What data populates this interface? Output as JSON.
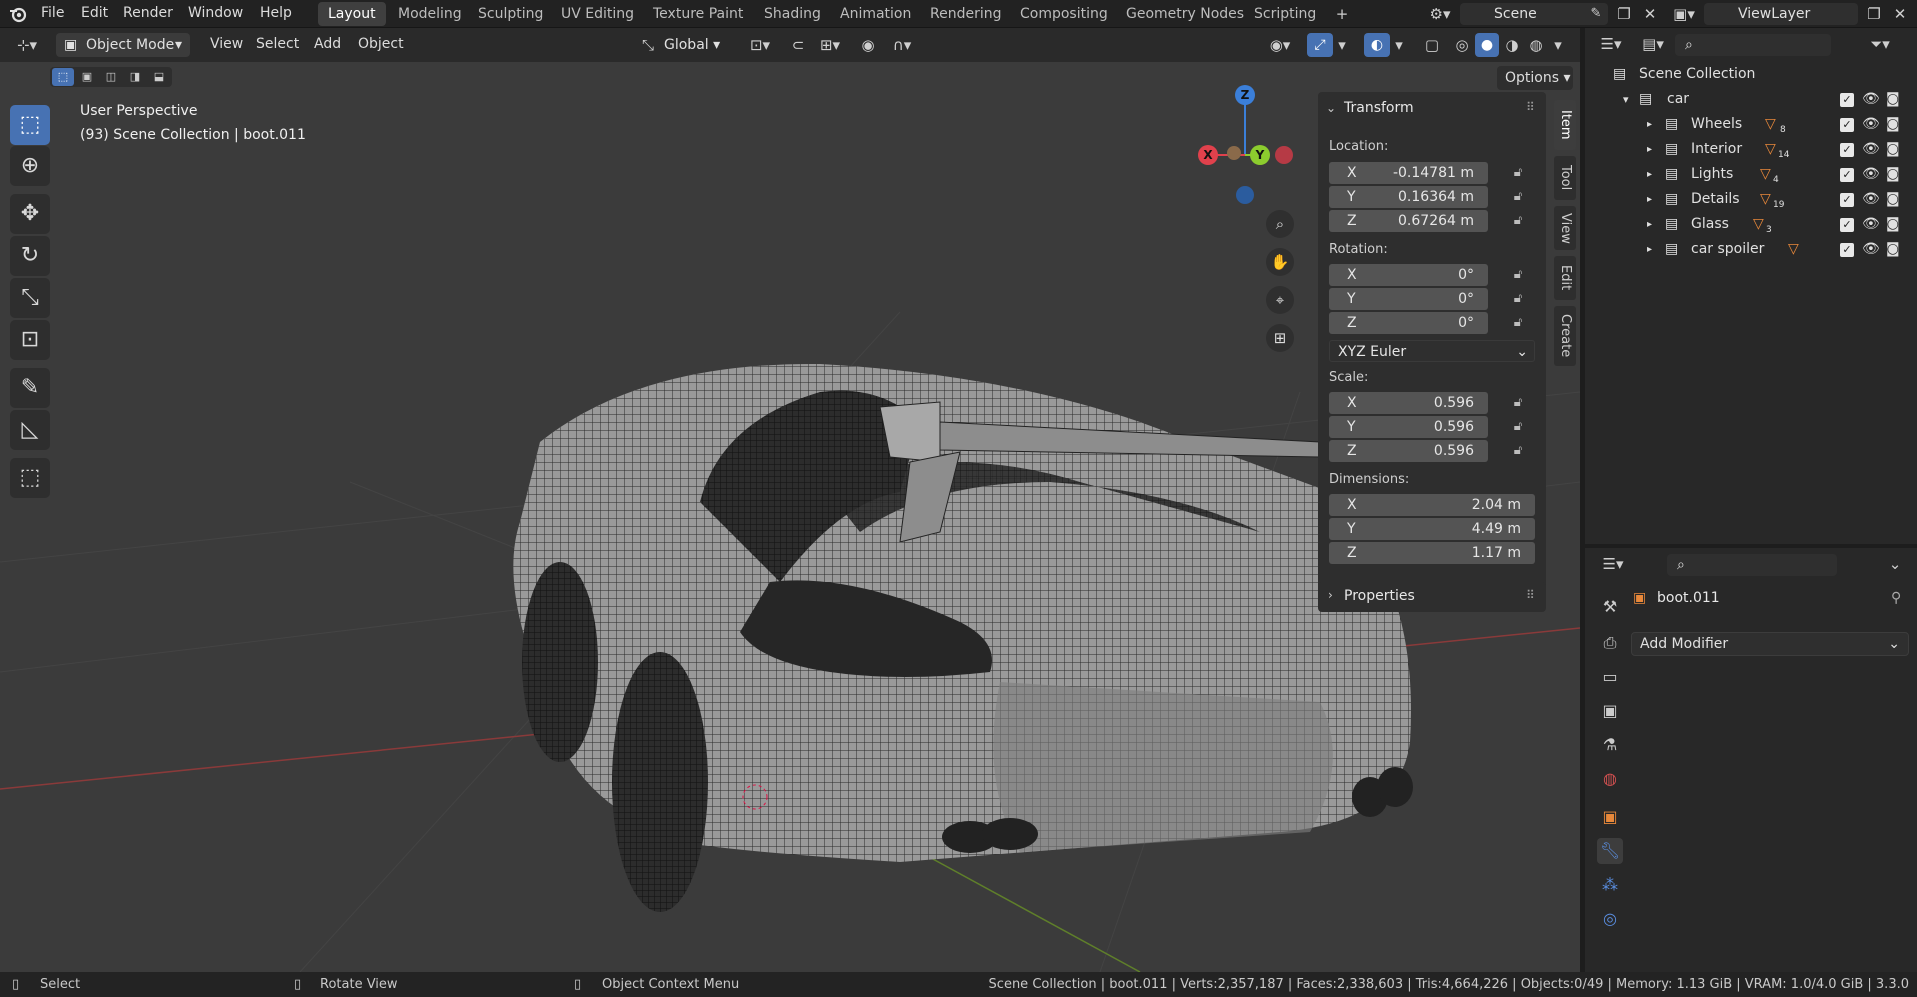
{
  "app": {
    "logo_icon": "blender-logo-icon"
  },
  "menus": [
    "File",
    "Edit",
    "Render",
    "Window",
    "Help"
  ],
  "workspaces": [
    "Layout",
    "Modeling",
    "Sculpting",
    "UV Editing",
    "Texture Paint",
    "Shading",
    "Animation",
    "Rendering",
    "Compositing",
    "Geometry Nodes",
    "Scripting"
  ],
  "active_workspace": "Layout",
  "scene": {
    "name": "Scene",
    "view_layer": "ViewLayer"
  },
  "header": {
    "mode": "Object Mode",
    "menus": [
      "View",
      "Select",
      "Add",
      "Object"
    ],
    "orientation": "Global",
    "options": "Options"
  },
  "viewport": {
    "perspective": "User Perspective",
    "context": "(93) Scene Collection | boot.011",
    "gizmo_labels": {
      "x": "X",
      "y": "Y",
      "z": "Z"
    }
  },
  "npanel": {
    "tabs": [
      "Item",
      "Tool",
      "View",
      "Edit",
      "Create"
    ],
    "transform_title": "Transform",
    "location_label": "Location:",
    "location": [
      {
        "axis": "X",
        "value": "-0.14781 m"
      },
      {
        "axis": "Y",
        "value": "0.16364 m"
      },
      {
        "axis": "Z",
        "value": "0.67264 m"
      }
    ],
    "rotation_label": "Rotation:",
    "rotation": [
      {
        "axis": "X",
        "value": "0°"
      },
      {
        "axis": "Y",
        "value": "0°"
      },
      {
        "axis": "Z",
        "value": "0°"
      }
    ],
    "rotation_mode": "XYZ Euler",
    "scale_label": "Scale:",
    "scale": [
      {
        "axis": "X",
        "value": "0.596"
      },
      {
        "axis": "Y",
        "value": "0.596"
      },
      {
        "axis": "Z",
        "value": "0.596"
      }
    ],
    "dimensions_label": "Dimensions:",
    "dimensions": [
      {
        "axis": "X",
        "value": "2.04 m"
      },
      {
        "axis": "Y",
        "value": "4.49 m"
      },
      {
        "axis": "Z",
        "value": "1.17 m"
      }
    ],
    "properties_title": "Properties"
  },
  "outliner": {
    "root": "Scene Collection",
    "collection": "car",
    "children": [
      {
        "name": "Wheels",
        "count": "8"
      },
      {
        "name": "Interior",
        "count": "14"
      },
      {
        "name": "Lights",
        "count": "4"
      },
      {
        "name": "Details",
        "count": "19"
      },
      {
        "name": "Glass",
        "count": "3"
      },
      {
        "name": "car spoiler",
        "count": ""
      }
    ]
  },
  "properties": {
    "object_name": "boot.011",
    "add_modifier": "Add Modifier"
  },
  "status": {
    "select": "Select",
    "rotate": "Rotate View",
    "context_menu": "Object Context Menu",
    "stats": "Scene Collection | boot.011 | Verts:2,357,187 | Faces:2,338,603 | Tris:4,664,226 | Objects:0/49 | Memory: 1.13 GiB | VRAM: 1.0/4.0 GiB | 3.3.0"
  },
  "colors": {
    "accent": "#4772b3",
    "x_axis": "#e0414c",
    "y_axis": "#8ccc2e",
    "z_axis": "#3b7fd9",
    "orange": "#e8883a"
  }
}
